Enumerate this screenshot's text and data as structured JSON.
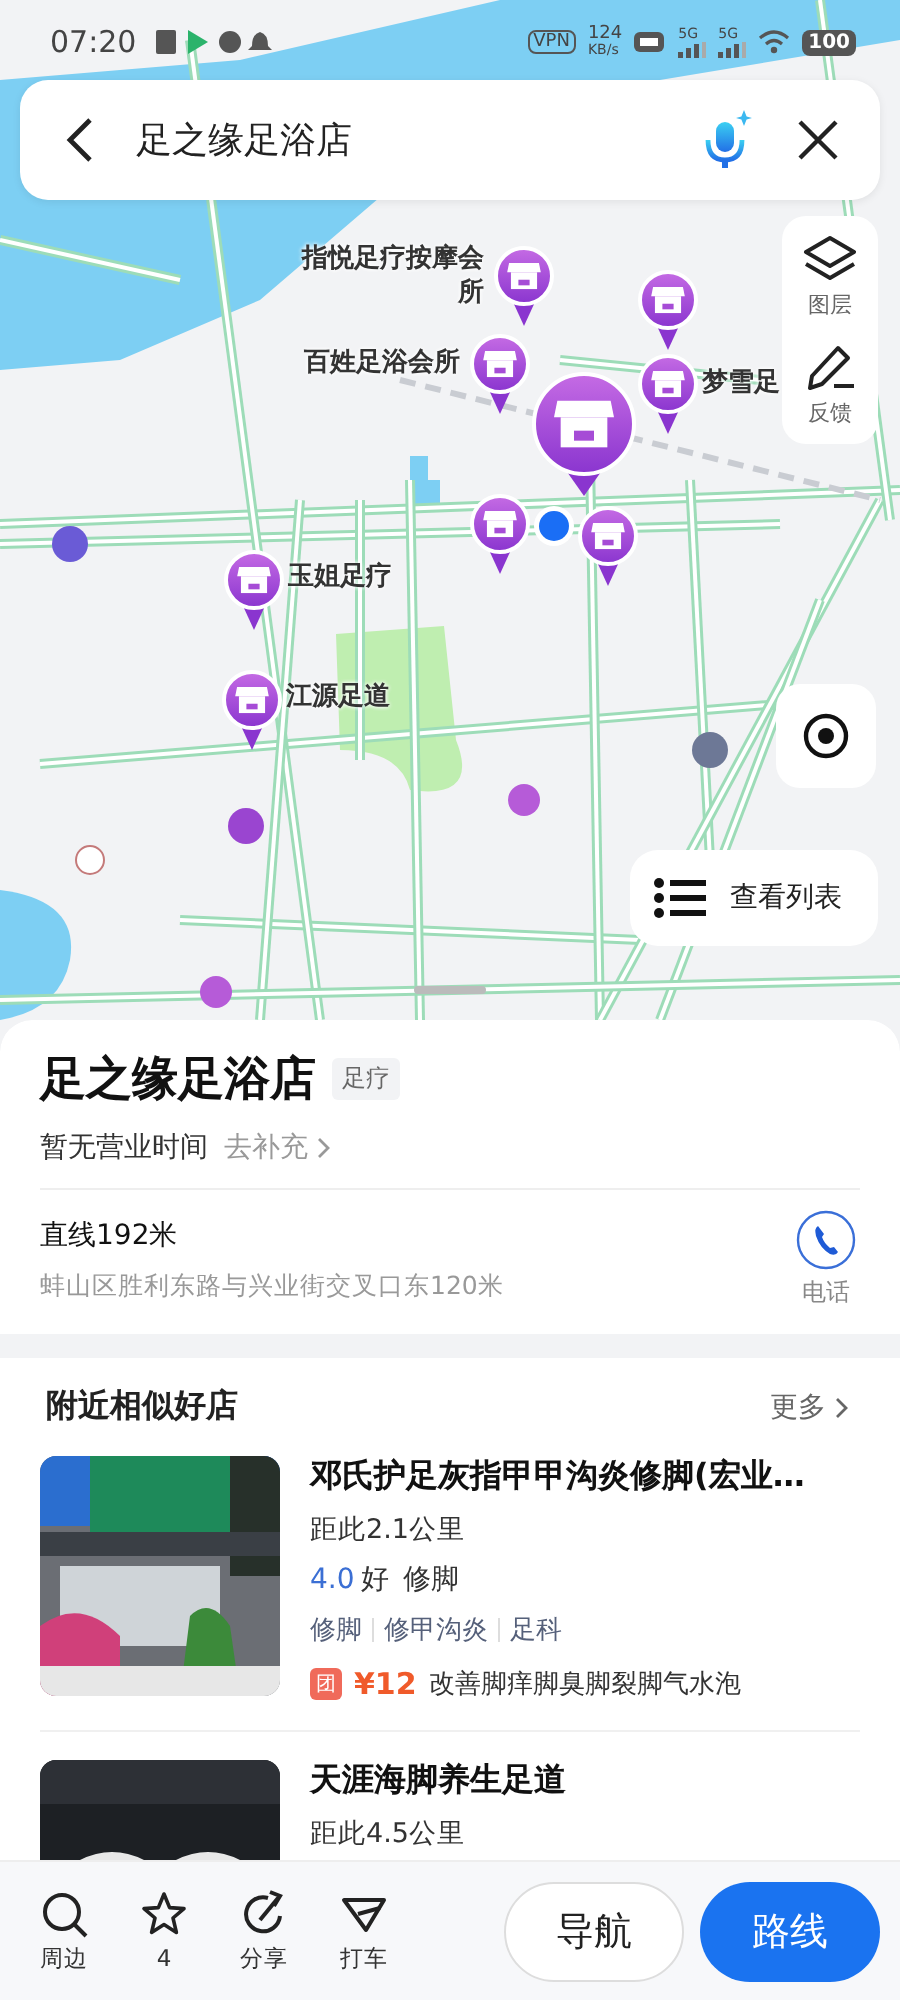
{
  "status_bar": {
    "time": "07:20",
    "vpn": "VPN",
    "speed": "124",
    "speed_unit": "KB/s",
    "signals": [
      "5G",
      "5G"
    ],
    "battery": "100"
  },
  "search": {
    "value": "足之缘足浴店"
  },
  "map_tools": [
    {
      "kind": "layers",
      "label": "图层"
    },
    {
      "kind": "feedback",
      "label": "反馈"
    }
  ],
  "pois": [
    {
      "name": "指悦足疗按摩会所",
      "selected": false
    },
    {
      "name": "百姓足浴会所",
      "selected": false
    },
    {
      "selected": false
    },
    {
      "name": "梦雪足",
      "selected": false
    },
    {
      "selected": true
    },
    {
      "selected": false
    },
    {
      "selected": false
    },
    {
      "name": "玉姐足疗",
      "selected": false
    },
    {
      "name": "江源足道",
      "selected": false
    }
  ],
  "list_button": "查看列表",
  "place": {
    "title": "足之缘足浴店",
    "tag": "足疗",
    "hours": "暂无营业时间",
    "hours_link": "去补充",
    "distance": "直线192米",
    "address": "蚌山区胜利东路与兴业街交叉口东120米",
    "phone": "电话"
  },
  "nearby": {
    "title": "附近相似好店",
    "more": "更多",
    "shops": [
      {
        "name": "邓氏护足灰指甲甲沟炎修脚(宏业…",
        "distance": "距此2.1公里",
        "rating": "4.0",
        "rating_word": "好",
        "category": "修脚",
        "tags": [
          "修脚",
          "修甲沟炎",
          "足科"
        ],
        "deal": {
          "badge": "团",
          "price": "¥12",
          "text": "改善脚痒脚臭脚裂脚气水泡"
        }
      },
      {
        "name": "天涯海脚养生足道",
        "distance": "距此4.5公里"
      }
    ]
  },
  "actions": [
    {
      "kind": "search",
      "label": "周边"
    },
    {
      "kind": "star",
      "label": "4"
    },
    {
      "kind": "share",
      "label": "分享"
    },
    {
      "kind": "taxi",
      "label": "打车"
    }
  ],
  "buttons": [
    {
      "kind": "secondary",
      "label": "导航"
    },
    {
      "kind": "primary",
      "label": "路线"
    }
  ]
}
